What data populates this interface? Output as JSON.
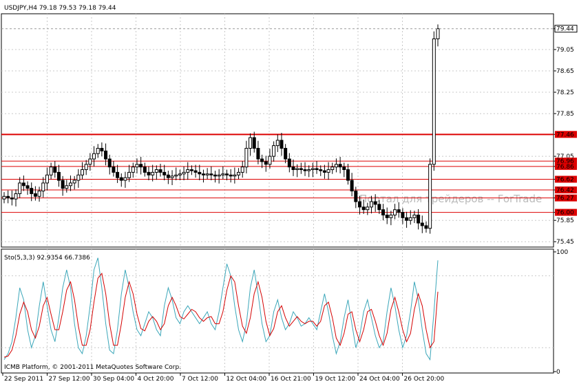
{
  "app": "ICMB Platform",
  "chart_data": [
    {
      "type": "candlestick",
      "title": "USDJPY,H4  79.18 79.53 79.18 79.44",
      "symbol": "USDJPY",
      "timeframe": "H4",
      "ohlc_header": {
        "open": 79.18,
        "high": 79.53,
        "low": 79.18,
        "close": 79.44
      },
      "current_price": 79.44,
      "ylim": [
        75.35,
        79.72
      ],
      "y_ticks": [
        "79.44",
        "79.05",
        "78.65",
        "78.25",
        "77.85",
        "77.46",
        "77.05",
        "76.96",
        "76.86",
        "76.62",
        "76.42",
        "76.27",
        "76.00",
        "75.85",
        "75.45"
      ],
      "grid": true,
      "watermark": "Портал для трейдеров -- ForTrade",
      "horizontal_levels": [
        {
          "value": 77.46,
          "label": "77.46",
          "color": "#dd0000"
        },
        {
          "value": 76.96,
          "label": "76.96",
          "color": "#dd0000"
        },
        {
          "value": 76.86,
          "label": "76.86",
          "color": "#dd0000"
        },
        {
          "value": 76.62,
          "label": "76.62",
          "color": "#dd0000"
        },
        {
          "value": 76.42,
          "label": "76.42",
          "color": "#dd0000"
        },
        {
          "value": 76.27,
          "label": "76.27",
          "color": "#dd0000"
        },
        {
          "value": 76.0,
          "label": "76.00",
          "color": "#dd0000"
        }
      ],
      "closes": [
        76.3,
        76.27,
        76.25,
        76.35,
        76.55,
        76.5,
        76.45,
        76.35,
        76.3,
        76.4,
        76.55,
        76.7,
        76.85,
        76.75,
        76.6,
        76.45,
        76.5,
        76.55,
        76.6,
        76.7,
        76.8,
        76.9,
        77.0,
        77.1,
        77.2,
        77.15,
        77.0,
        76.85,
        76.75,
        76.65,
        76.6,
        76.65,
        76.75,
        76.85,
        76.9,
        76.85,
        76.75,
        76.7,
        76.75,
        76.8,
        76.75,
        76.7,
        76.65,
        76.68,
        76.7,
        76.72,
        76.75,
        76.8,
        76.78,
        76.75,
        76.72,
        76.7,
        76.72,
        76.7,
        76.68,
        76.7,
        76.72,
        76.7,
        76.68,
        76.7,
        76.75,
        76.85,
        77.2,
        77.4,
        77.2,
        77.0,
        76.95,
        76.9,
        77.05,
        77.25,
        77.35,
        77.2,
        77.0,
        76.85,
        76.8,
        76.82,
        76.8,
        76.78,
        76.8,
        76.82,
        76.8,
        76.78,
        76.75,
        76.8,
        76.85,
        76.9,
        76.85,
        76.8,
        76.6,
        76.4,
        76.2,
        76.1,
        76.05,
        76.1,
        76.2,
        76.15,
        76.05,
        75.95,
        75.9,
        75.95,
        76.05,
        76.0,
        75.9,
        75.85,
        75.9,
        75.95,
        75.8,
        75.75,
        75.7,
        76.9,
        79.25,
        79.44
      ],
      "x_tick_labels": [
        "22 Sep 2011",
        "27 Sep 12:00",
        "30 Sep 04:00",
        "4 Oct 20:00",
        "7 Oct 12:00",
        "12 Oct 04:00",
        "16 Oct 21:00",
        "19 Oct 12:00",
        "24 Oct 04:00",
        "26 Oct 20:00"
      ]
    },
    {
      "type": "line",
      "title": "Sto(5,3,3) 92.9354 66.7386",
      "indicator": "Sto(5,3,3)",
      "main_value": 92.9354,
      "signal_value": 66.7386,
      "ylim": [
        0,
        100
      ],
      "y_ticks": [
        "100",
        "0"
      ],
      "series": [
        {
          "color": "#3aa6b9",
          "values": [
            10,
            15,
            25,
            45,
            70,
            60,
            35,
            20,
            30,
            55,
            75,
            55,
            35,
            25,
            45,
            70,
            85,
            70,
            40,
            20,
            15,
            30,
            55,
            85,
            95,
            70,
            40,
            18,
            15,
            35,
            65,
            85,
            70,
            50,
            35,
            30,
            40,
            50,
            45,
            35,
            30,
            55,
            70,
            60,
            45,
            40,
            50,
            55,
            50,
            45,
            40,
            45,
            50,
            40,
            35,
            50,
            70,
            90,
            80,
            55,
            35,
            25,
            40,
            70,
            85,
            65,
            40,
            25,
            30,
            50,
            60,
            45,
            35,
            40,
            50,
            45,
            38,
            40,
            45,
            40,
            35,
            50,
            65,
            50,
            30,
            15,
            25,
            45,
            60,
            40,
            20,
            30,
            50,
            60,
            45,
            30,
            20,
            25,
            50,
            70,
            55,
            35,
            20,
            30,
            50,
            75,
            60,
            35,
            15,
            10,
            50,
            92.9354
          ]
        },
        {
          "color": "#d40000",
          "values": [
            12,
            13,
            18,
            30,
            48,
            58,
            50,
            35,
            28,
            38,
            55,
            62,
            48,
            35,
            35,
            50,
            68,
            75,
            60,
            38,
            22,
            22,
            35,
            58,
            78,
            82,
            65,
            40,
            22,
            22,
            40,
            62,
            75,
            65,
            48,
            36,
            34,
            42,
            46,
            42,
            35,
            40,
            55,
            62,
            55,
            46,
            44,
            48,
            52,
            50,
            45,
            42,
            45,
            46,
            40,
            40,
            50,
            68,
            80,
            75,
            55,
            38,
            32,
            45,
            65,
            75,
            62,
            42,
            30,
            36,
            50,
            55,
            45,
            38,
            42,
            46,
            42,
            40,
            42,
            42,
            38,
            42,
            55,
            58,
            45,
            28,
            22,
            32,
            48,
            50,
            35,
            25,
            35,
            50,
            52,
            42,
            30,
            22,
            32,
            52,
            62,
            50,
            35,
            25,
            32,
            52,
            65,
            55,
            35,
            20,
            25,
            66.7386
          ]
        }
      ]
    }
  ],
  "footer": {
    "copyright": "ICMB Platform, © 2001-2011 MetaQuotes Software Corp."
  }
}
